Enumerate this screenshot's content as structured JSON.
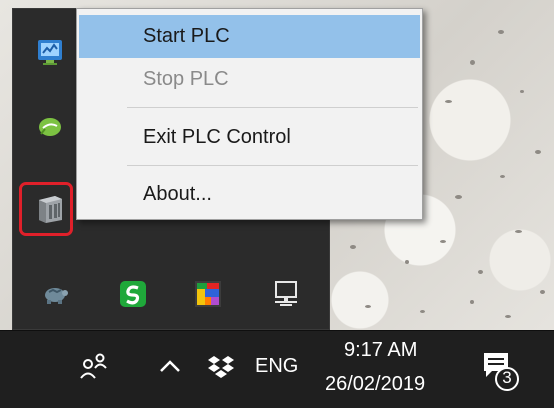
{
  "context_menu": {
    "items": [
      {
        "label": "Start PLC",
        "state": "selected"
      },
      {
        "label": "Stop PLC",
        "state": "disabled"
      },
      {
        "label": "Exit PLC Control",
        "state": "normal"
      },
      {
        "label": "About...",
        "state": "normal"
      }
    ]
  },
  "tray_flyout": {
    "icons": [
      {
        "name": "network-monitor-icon"
      },
      {
        "name": "green-leaf-icon"
      },
      {
        "name": "plc-control-icon",
        "highlighted": true
      },
      {
        "name": "turtle-icon"
      },
      {
        "name": "green-s-icon"
      },
      {
        "name": "colorful-grid-icon"
      },
      {
        "name": "network-computer-icon"
      }
    ]
  },
  "taskbar": {
    "language": "ENG",
    "time": "9:17 AM",
    "date": "26/02/2019",
    "notification_count": "3"
  },
  "colors": {
    "menu_highlight": "#93c1ea",
    "red_outline": "#e0202a",
    "taskbar": "#1f1f1f"
  }
}
